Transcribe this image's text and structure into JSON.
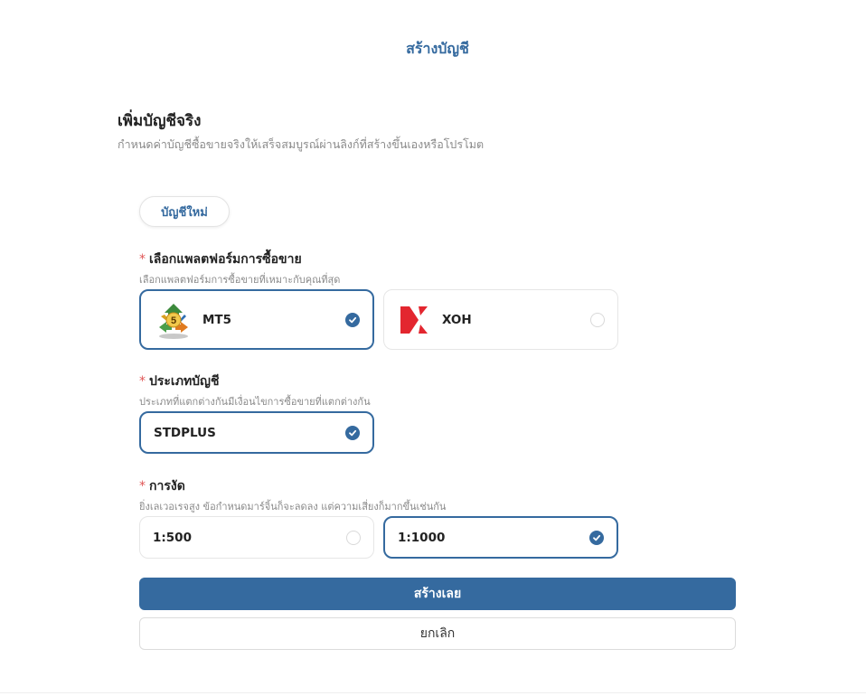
{
  "page": {
    "title": "สร้างบัญชี"
  },
  "form": {
    "heading": "เพิ่มบัญชีจริง",
    "subheading": "กำหนดค่าบัญชีซื้อขายจริงให้เสร็จสมบูรณ์ผ่านลิงก์ที่สร้างขึ้นเองหรือโปรโมต",
    "tab_label": "บัญชีใหม่",
    "required_mark": "*"
  },
  "platform": {
    "label": "เลือกแพลตฟอร์มการซื้อขาย",
    "hint": "เลือกแพลตฟอร์มการซื้อขายที่เหมาะกับคุณที่สุด",
    "options": [
      {
        "label": "MT5",
        "icon": "mt5-logo-icon",
        "selected": true
      },
      {
        "label": "XOH",
        "icon": "xoh-logo-icon",
        "selected": false
      }
    ]
  },
  "account_type": {
    "label": "ประเภทบัญชี",
    "hint": "ประเภทที่แตกต่างกันมีเงื่อนไขการซื้อขายที่แตกต่างกัน",
    "options": [
      {
        "label": "STDPLUS",
        "selected": true
      }
    ]
  },
  "leverage": {
    "label": "การงัด",
    "hint": "ยิ่งเลเวอเรจสูง ข้อกำหนดมาร์จิ้นก็จะลดลง แต่ความเสี่ยงก็มากขึ้นเช่นกัน",
    "options": [
      {
        "label": "1:500",
        "selected": false
      },
      {
        "label": "1:1000",
        "selected": true
      }
    ]
  },
  "actions": {
    "create_label": "สร้างเลย",
    "cancel_label": "ยกเลิก"
  },
  "colors": {
    "accent": "#356a9f",
    "required": "#e05555",
    "xoh_red": "#e3262f"
  }
}
